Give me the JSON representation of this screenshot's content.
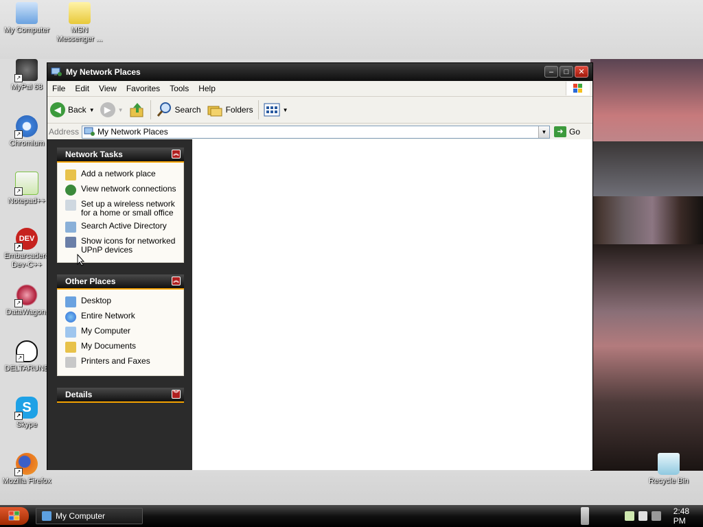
{
  "desktop": {
    "icons": [
      {
        "label": "My Computer",
        "name": "desktop-icon-my-computer",
        "color": "#6aa2e0"
      },
      {
        "label": "MSN Messenger ...",
        "name": "desktop-icon-msn-messenger",
        "color": "#e8c93a"
      },
      {
        "label": "MyPal 68",
        "name": "desktop-icon-mypal",
        "color": "#222222"
      },
      {
        "label": "Chromium",
        "name": "desktop-icon-chromium",
        "color": "#3b7fd9"
      },
      {
        "label": "Notepad++",
        "name": "desktop-icon-notepadpp",
        "color": "#7ec245"
      },
      {
        "label": "Embarcadero Dev-C++",
        "name": "desktop-icon-devcpp",
        "color": "#c6221e"
      },
      {
        "label": "DataWagon.",
        "name": "desktop-icon-datawagon",
        "color": "#b01e3a"
      },
      {
        "label": "DELTARUNE",
        "name": "desktop-icon-deltarune",
        "color": "#111111"
      },
      {
        "label": "Skype",
        "name": "desktop-icon-skype",
        "color": "#1ea1e6"
      },
      {
        "label": "Mozilla Firefox",
        "name": "desktop-icon-firefox",
        "color": "#e8731e"
      },
      {
        "label": "Recycle Bin",
        "name": "desktop-icon-recycle-bin",
        "color": "#8fc9e0"
      }
    ]
  },
  "window": {
    "title": "My Network Places",
    "menu": [
      "File",
      "Edit",
      "View",
      "Favorites",
      "Tools",
      "Help"
    ],
    "toolbar": {
      "back": "Back",
      "search": "Search",
      "folders": "Folders"
    },
    "address": {
      "label": "Address",
      "value": "My Network Places",
      "go": "Go"
    },
    "panels": {
      "network_tasks": {
        "title": "Network Tasks",
        "items": [
          {
            "label": "Add a network place",
            "icon": "add-network-place-icon"
          },
          {
            "label": "View network connections",
            "icon": "network-connections-icon"
          },
          {
            "label": "Set up a wireless network for a home or small office",
            "icon": "wireless-network-icon"
          },
          {
            "label": "Search Active Directory",
            "icon": "search-directory-icon"
          },
          {
            "label": "Show icons for networked UPnP devices",
            "icon": "upnp-devices-icon"
          }
        ]
      },
      "other_places": {
        "title": "Other Places",
        "items": [
          {
            "label": "Desktop",
            "icon": "desktop-icon"
          },
          {
            "label": "Entire Network",
            "icon": "entire-network-icon"
          },
          {
            "label": "My Computer",
            "icon": "my-computer-icon"
          },
          {
            "label": "My Documents",
            "icon": "my-documents-icon"
          },
          {
            "label": "Printers and Faxes",
            "icon": "printers-faxes-icon"
          }
        ]
      },
      "details": {
        "title": "Details"
      }
    }
  },
  "taskbar": {
    "task_label": "My Computer",
    "clock": "2:48 PM"
  },
  "colors": {
    "panel_accent": "#f5a300",
    "title_bar": "#1a1a1a",
    "close_button": "#c0301c"
  }
}
